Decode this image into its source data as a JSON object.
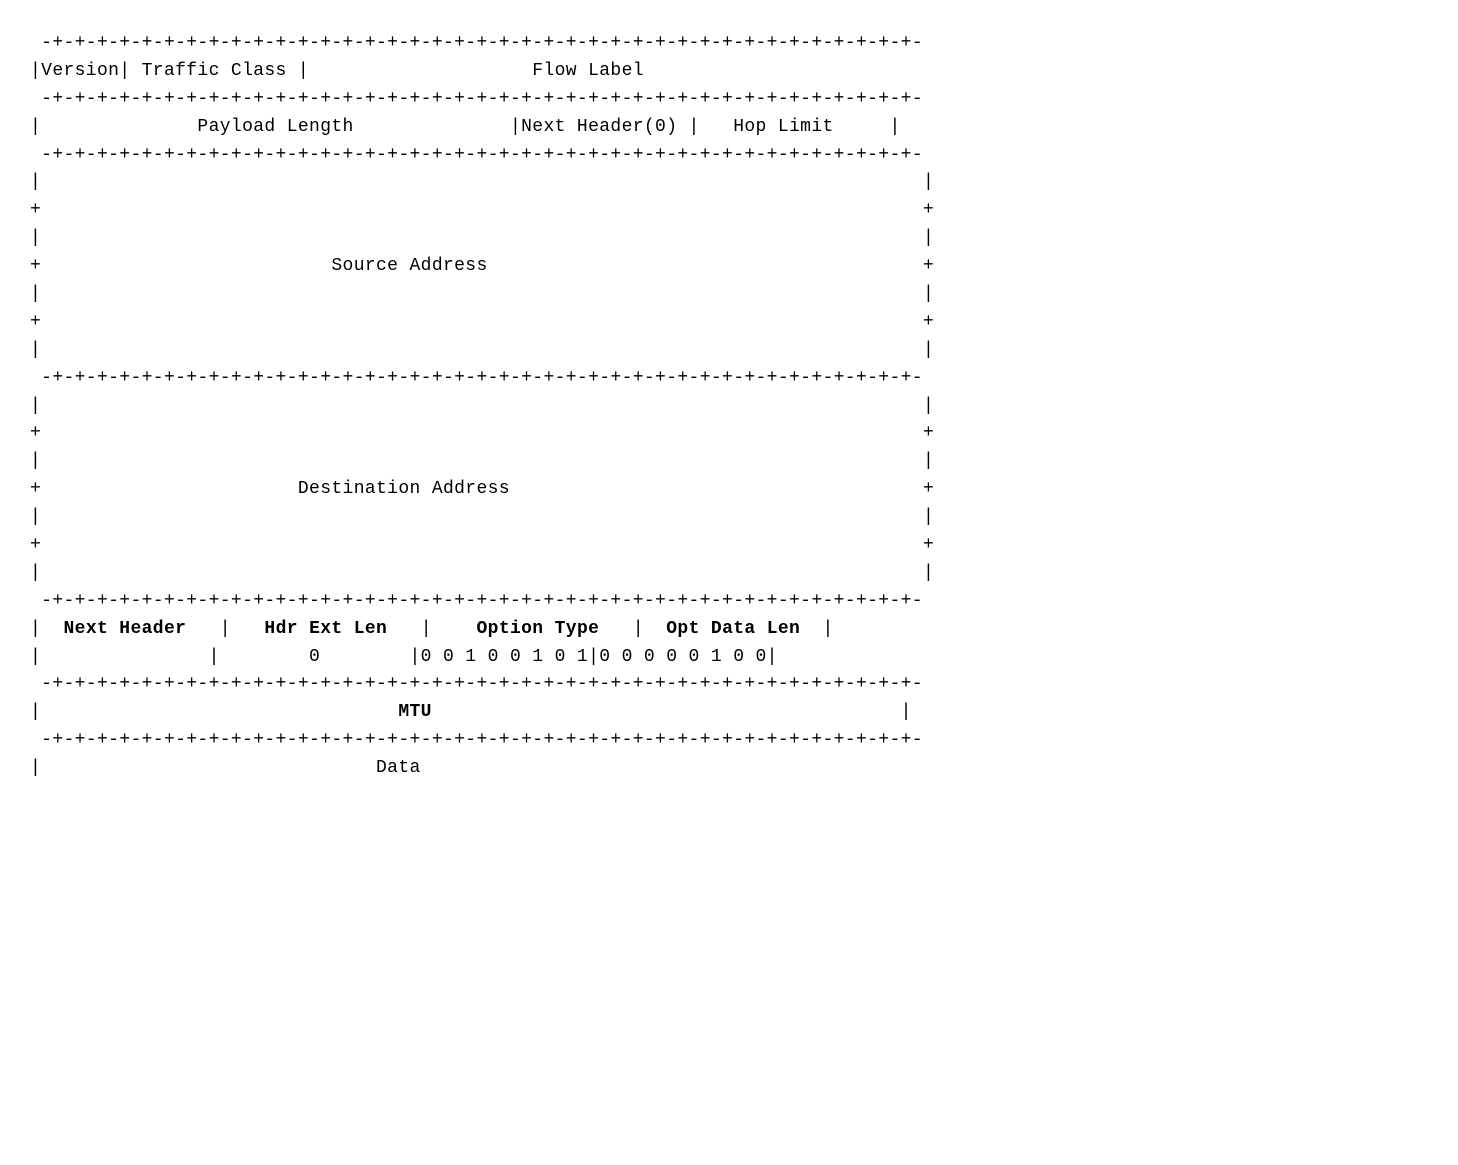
{
  "diagram": {
    "lines": [
      " +-+-+-+-+-+-+-+-+-+-+-+-+-+-+-+-+-+-+-+-+-+-+-+-+-+-+-+-+-+-+-+-+-+-+-+-+-+",
      " |Version| Traffic Class |                    Flow Label                    ",
      " +-+-+-+-+-+-+-+-+-+-+-+-+-+-+-+-+-+-+-+-+-+-+-+-+-+-+-+-+-+-+-+-+-+-+-+-+-+",
      " |                   Payload Length             |Next Header(0) |  Hop Limit |",
      " +-+-+-+-+-+-+-+-+-+-+-+-+-+-+-+-+-+-+-+-+-+-+-+-+-+-+-+-+-+-+-+-+-+-+-+-+-+",
      " |                                                                           |",
      " +                                                                           +",
      " |                                                                           |",
      " +                         Source Address                                   +",
      " |                                                                           |",
      " +                                                                           +",
      " |                                                                           |",
      " +-+-+-+-+-+-+-+-+-+-+-+-+-+-+-+-+-+-+-+-+-+-+-+-+-+-+-+-+-+-+-+-+-+-+-+-+-+",
      " |                                                                           |",
      " +                                                                           +",
      " |                                                                           |",
      " +                       Destination Address                                +",
      " |                                                                           |",
      " +                                                                           +",
      " |                                                                           |",
      " +-+-+-+-+-+-+-+-+-+-+-+-+-+-+-+-+-+-+-+-+-+-+-+-+-+-+-+-+-+-+-+-+-+-+-+-+-+",
      " |  Next Header  |   Hdr Ext Len   |   Option Type   |   Opt Data Len  |",
      " |               |        0        |0 0 1 0 0 1 0 1|0 0 0 0 0 1 0 0|",
      " +-+-+-+-+-+-+-+-+-+-+-+-+-+-+-+-+-+-+-+-+-+-+-+-+-+-+-+-+-+-+-+-+-+-+-+-+-+",
      " |                               MTU                                        |",
      " +-+-+-+-+-+-+-+-+-+-+-+-+-+-+-+-+-+-+-+-+-+-+-+-+-+-+-+-+-+-+-+-+-+-+-+-+-+",
      " |                              Data                                         "
    ]
  }
}
